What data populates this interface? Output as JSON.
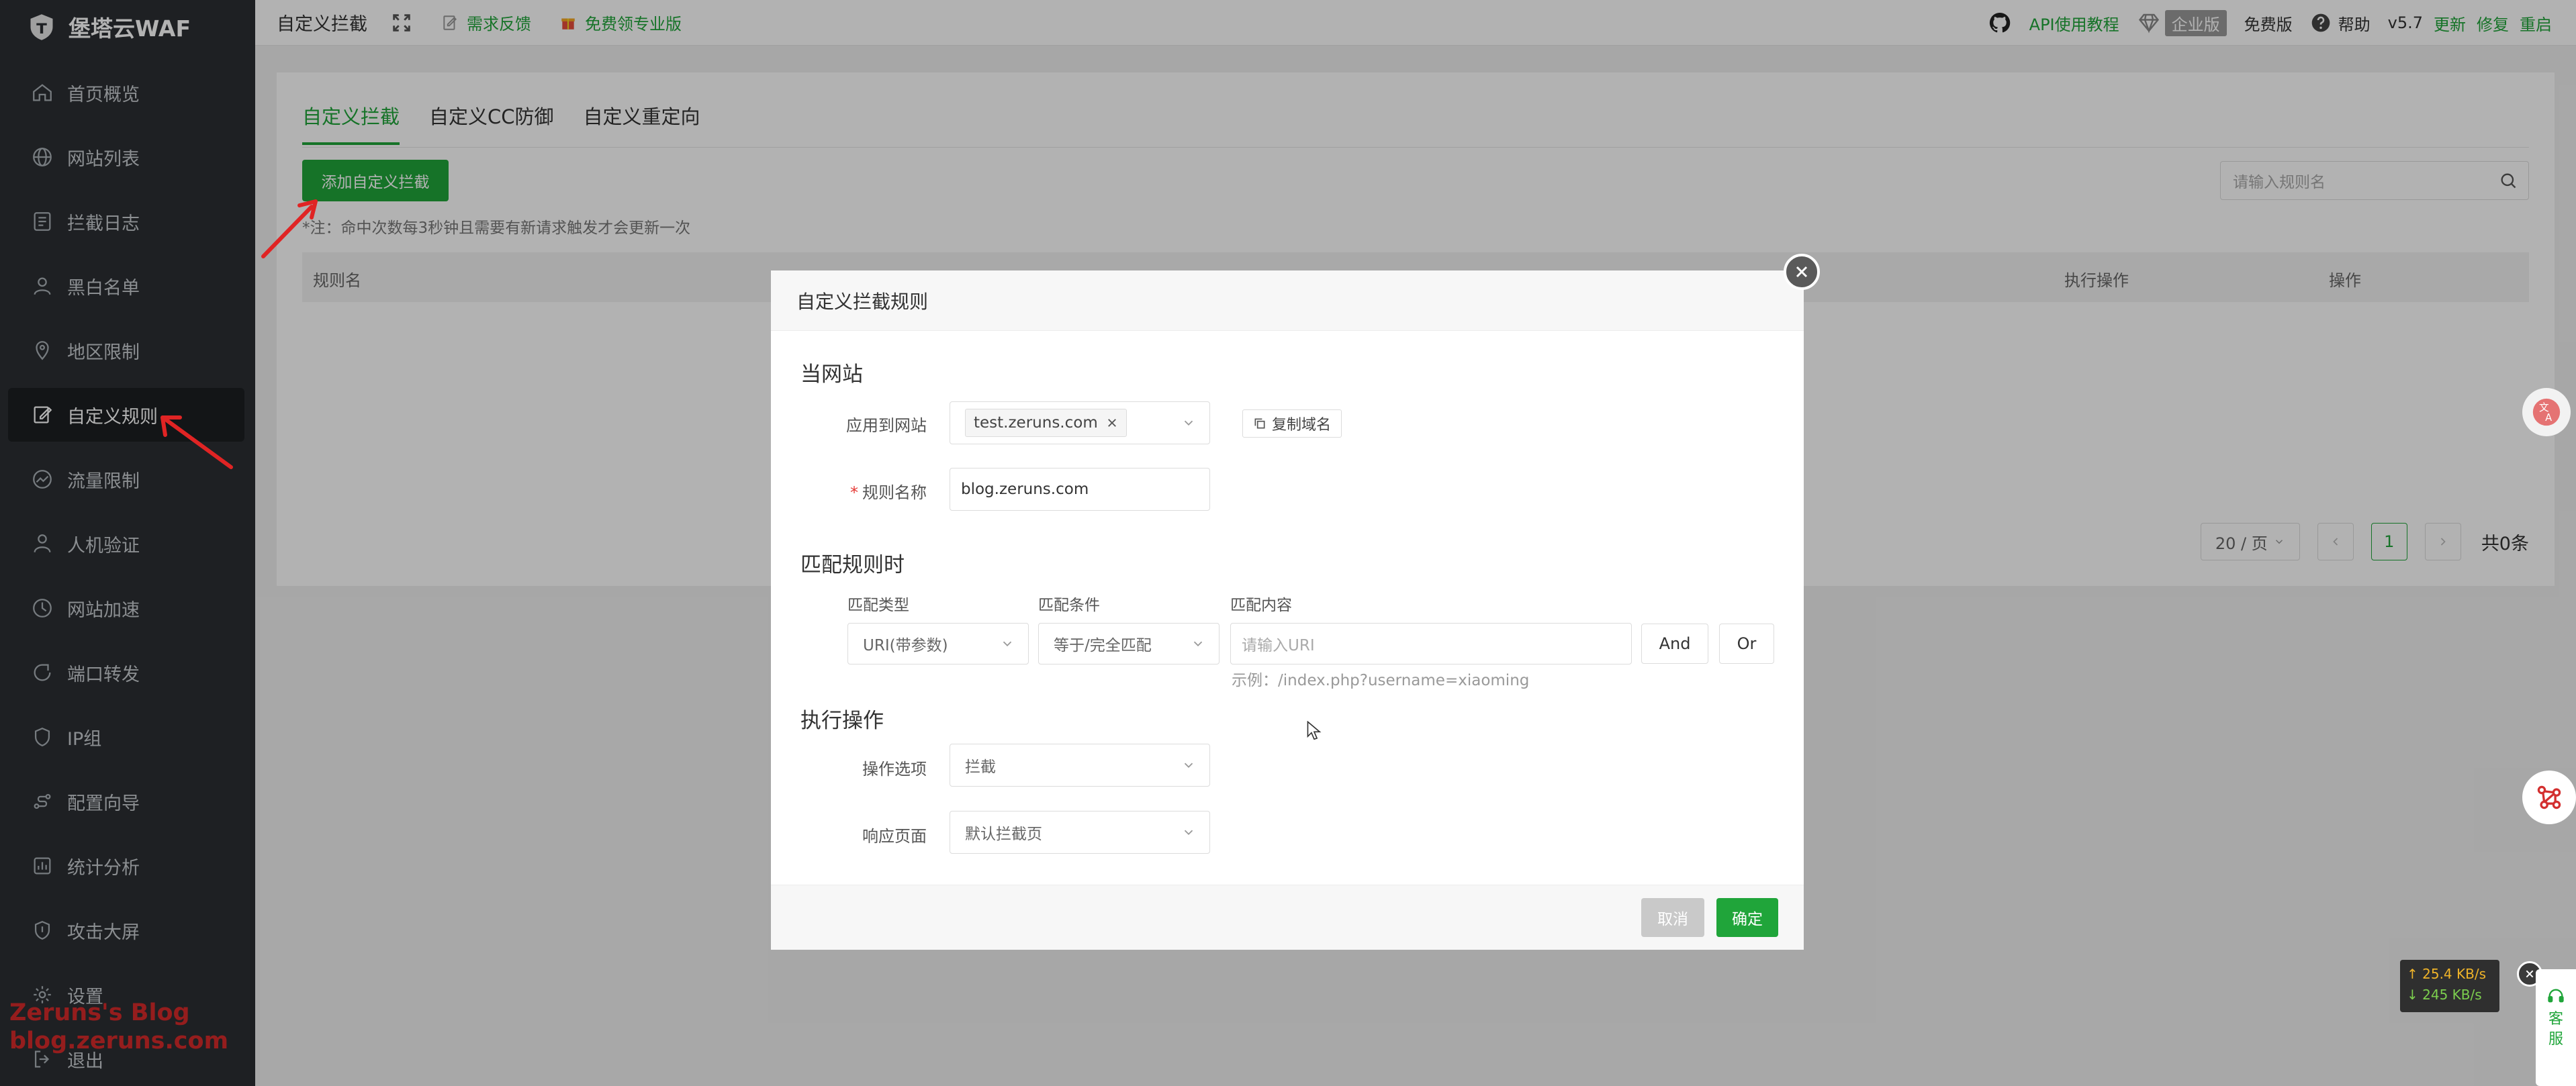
{
  "app": {
    "title": "堡塔云WAF"
  },
  "sidebar": {
    "items": [
      {
        "label": "首页概览",
        "icon": "home-icon"
      },
      {
        "label": "网站列表",
        "icon": "globe-icon"
      },
      {
        "label": "拦截日志",
        "icon": "log-icon"
      },
      {
        "label": "黑白名单",
        "icon": "user-icon"
      },
      {
        "label": "地区限制",
        "icon": "location-icon"
      },
      {
        "label": "自定义规则",
        "icon": "edit-icon",
        "active": true
      },
      {
        "label": "流量限制",
        "icon": "gauge-icon"
      },
      {
        "label": "人机验证",
        "icon": "person-icon"
      },
      {
        "label": "网站加速",
        "icon": "rocket-icon"
      },
      {
        "label": "端口转发",
        "icon": "forward-icon"
      },
      {
        "label": "IP组",
        "icon": "shield-icon"
      },
      {
        "label": "配置向导",
        "icon": "guide-icon"
      },
      {
        "label": "统计分析",
        "icon": "chart-icon"
      },
      {
        "label": "攻击大屏",
        "icon": "screen-icon"
      },
      {
        "label": "设置",
        "icon": "gear-icon"
      },
      {
        "label": "退出",
        "icon": "logout-icon"
      }
    ],
    "watermark_line1": "Zeruns's Blog",
    "watermark_line2": "blog.zeruns.com"
  },
  "topbar": {
    "breadcrumb": "自定义拦截",
    "feedback": "需求反馈",
    "free_pro": "免费领专业版",
    "api_tutorial": "API使用教程",
    "enterprise": "企业版",
    "free_edition": "免费版",
    "help": "帮助",
    "version": "v5.7",
    "update": "更新",
    "repair": "修复",
    "restart": "重启"
  },
  "main": {
    "tabs": [
      {
        "label": "自定义拦截",
        "active": true
      },
      {
        "label": "自定义CC防御"
      },
      {
        "label": "自定义重定向"
      }
    ],
    "add_button": "添加自定义拦截",
    "note": "*注：命中次数每3秒钟且需要有新请求触发才会更新一次",
    "search_placeholder": "请输入规则名",
    "table_headers": {
      "rule_name": "规则名",
      "action": "执行操作",
      "operation": "操作"
    },
    "pagination": {
      "page_size": "20 / 页",
      "current_page": "1",
      "total": "共0条"
    }
  },
  "dialog": {
    "title": "自定义拦截规则",
    "section_site": "当网站",
    "apply_site_label": "应用到网站",
    "apply_site_tag": "test.zeruns.com",
    "copy_domain": "复制域名",
    "rule_name_required": "*",
    "rule_name_label": "规则名称",
    "rule_name_value": "blog.zeruns.com",
    "section_match": "匹配规则时",
    "match_type_label": "匹配类型",
    "match_cond_label": "匹配条件",
    "match_content_label": "匹配内容",
    "match_type_value": "URI(带参数)",
    "match_cond_value": "等于/完全匹配",
    "match_content_placeholder": "请输入URI",
    "and_button": "And",
    "or_button": "Or",
    "example_hint": "示例：/index.php?username=xiaoming",
    "section_action": "执行操作",
    "action_option_label": "操作选项",
    "action_option_value": "拦截",
    "response_page_label": "响应页面",
    "response_page_value": "默认拦截页",
    "cancel": "取消",
    "confirm": "确定"
  },
  "widgets": {
    "upload_speed": "↑ 25.4 KB/s",
    "download_speed": "↓ 245 KB/s",
    "service_label_1": "客",
    "service_label_2": "服"
  },
  "colors": {
    "sidebar_bg": "#2b2f33",
    "accent_green": "#20a53a",
    "annotation_red": "#e02424"
  }
}
